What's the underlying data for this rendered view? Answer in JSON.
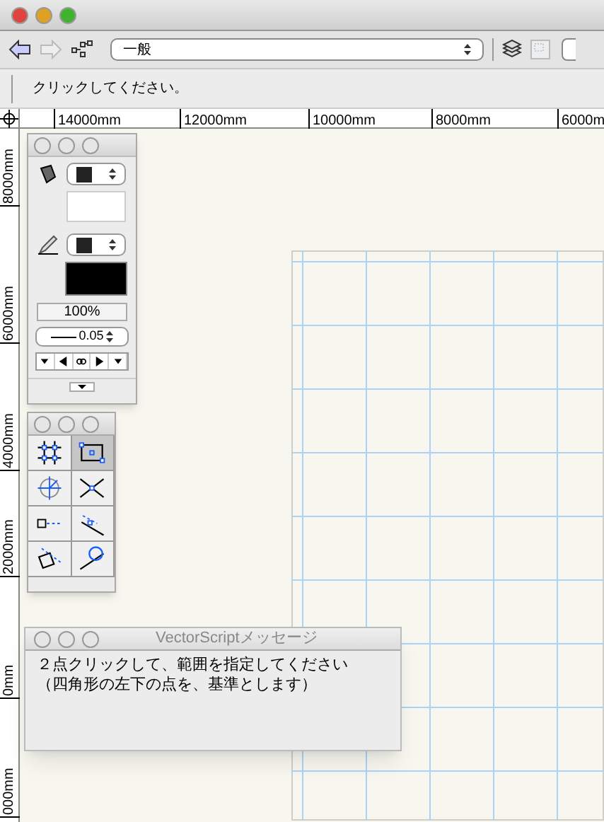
{
  "toolbar": {
    "class_dropdown": "一般"
  },
  "status_bar": {
    "message": "クリックしてください。"
  },
  "ruler": {
    "horizontal": [
      "14000mm",
      "12000mm",
      "10000mm",
      "8000mm",
      "6000m"
    ],
    "vertical": [
      "8000mm",
      "6000mm",
      "4000mm",
      "2000mm",
      "0mm",
      "000mm"
    ]
  },
  "attributes_palette": {
    "opacity": "100%",
    "line_weight": "0.05"
  },
  "tool_palette": {
    "tools": [
      {
        "kind": "grid",
        "selected": false
      },
      {
        "kind": "rect",
        "selected": true
      },
      {
        "kind": "circle",
        "selected": false
      },
      {
        "kind": "cross",
        "selected": false
      },
      {
        "kind": "dash",
        "selected": false
      },
      {
        "kind": "offset",
        "selected": false
      },
      {
        "kind": "square",
        "selected": false
      },
      {
        "kind": "tangent",
        "selected": false
      }
    ]
  },
  "message_window": {
    "title": "VectorScriptメッセージ",
    "lines": [
      "２点クリックして、範囲を指定してください",
      "（四角形の左下の点を、基準とします）"
    ]
  }
}
